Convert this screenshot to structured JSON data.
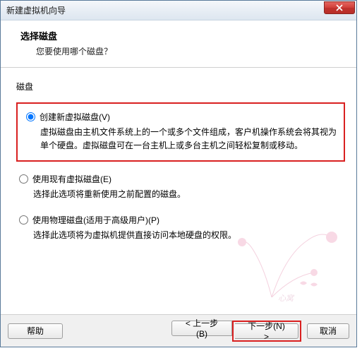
{
  "window": {
    "title": "新建虚拟机向导"
  },
  "header": {
    "title": "选择磁盘",
    "subtitle": "您要使用哪个磁盘？"
  },
  "section": {
    "label": "磁盘"
  },
  "options": [
    {
      "label": "创建新虚拟磁盘(V)",
      "desc": "虚拟磁盘由主机文件系统上的一个或多个文件组成，客户机操作系统会将其视为单个硬盘。虚拟磁盘可在一台主机上或多台主机之间轻松复制或移动。",
      "selected": true
    },
    {
      "label": "使用现有虚拟磁盘(E)",
      "desc": "选择此选项将重新使用之前配置的磁盘。",
      "selected": false
    },
    {
      "label": "使用物理磁盘(适用于高级用户)(P)",
      "desc": "选择此选项将为虚拟机提供直接访问本地硬盘的权限。",
      "selected": false
    }
  ],
  "buttons": {
    "help": "帮助",
    "prev": "< 上一步(B)",
    "next": "下一步(N) >",
    "cancel": "取消"
  }
}
